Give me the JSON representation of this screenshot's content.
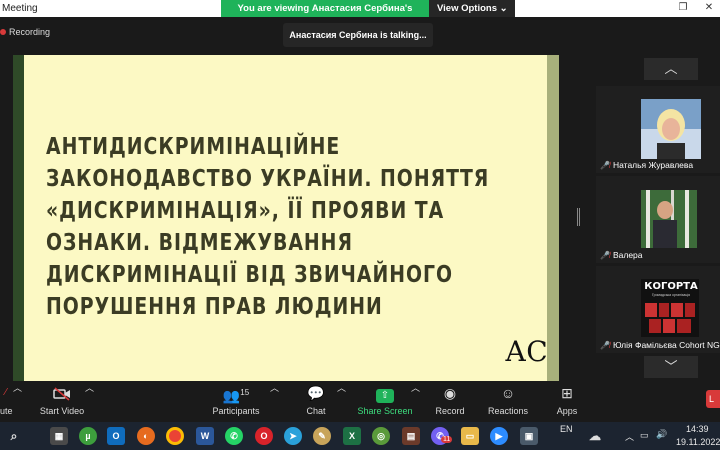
{
  "window": {
    "title": "Meeting"
  },
  "banner": {
    "viewing_text": "You are viewing Анастасия Сербина's screen",
    "view_options": "View Options ⌄"
  },
  "speaker": {
    "text": "Анастасия Сербина is talking..."
  },
  "recording": {
    "label": "Recording"
  },
  "slide": {
    "title_lines": [
      "АНТИДИСКРИМІНАЦІЙНЕ",
      "ЗАКОНОДАВСТВО УКРАЇНИ. ПОНЯТТЯ",
      "«ДИСКРИМІНАЦІЯ», ЇЇ ПРОЯВИ ТА",
      "ОЗНАКИ. ВІДМЕЖУВАННЯ",
      "ДИСКРИМІНАЦІЇ ВІД ЗВИЧАЙНОГО",
      "ПОРУШЕННЯ ПРАВ ЛЮДИНИ"
    ],
    "logo": "АС",
    "colors": {
      "background": "#fcf9c4",
      "text": "#3b3c24",
      "band": "#2f4a28"
    }
  },
  "participants": [
    {
      "name": "Наталья Журавлева",
      "muted": true
    },
    {
      "name": "Валера",
      "muted": true
    },
    {
      "name": "Юлія Фамільєва Cohort NG",
      "muted": true,
      "logo_text": "КОГОРТА",
      "logo_sub": "Громадська організація"
    }
  ],
  "controls": {
    "mute_partial": "ute",
    "start_video": "Start Video",
    "participants": "Participants",
    "participants_count": "15",
    "chat": "Chat",
    "share_screen": "Share Screen",
    "record": "Record",
    "reactions": "Reactions",
    "apps": "Apps",
    "leave_partial": "L"
  },
  "taskbar": {
    "language": "EN",
    "time": "14:39",
    "date": "19.11.2022",
    "icons": [
      "search-icon",
      "calculator-icon",
      "utorrent-icon",
      "outlook-icon",
      "firefox-icon",
      "chrome-icon",
      "word-icon",
      "whatsapp-icon",
      "opera-icon",
      "telegram-icon",
      "paint-icon",
      "excel-icon",
      "greenshot-icon",
      "library-icon",
      "viber-icon",
      "file-explorer-icon",
      "zoom-icon",
      "network-device-icon"
    ],
    "viber_badge": "11"
  },
  "colors": {
    "accent_green": "#1fb35a",
    "mute_red": "#d83a3a",
    "bar_bg": "#1a1a1a"
  }
}
